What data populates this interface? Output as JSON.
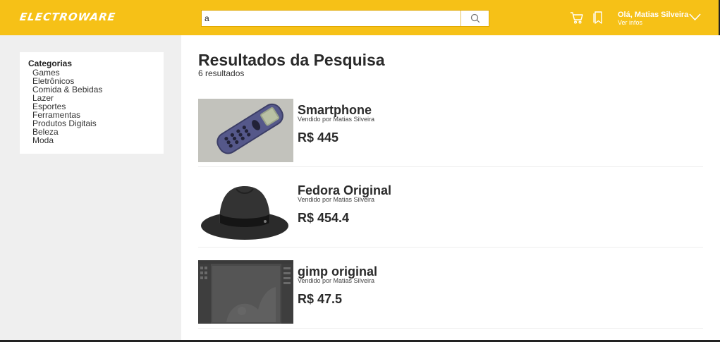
{
  "header": {
    "logo": "ELECTROWARE",
    "search_value": "a",
    "user_greeting": "Olá, Matias Silveira",
    "user_sub": "Ver infos",
    "accent_color": "#f6c117"
  },
  "sidebar": {
    "title": "Categorias",
    "items": [
      "Games",
      "Eletrônicos",
      "Comida & Bebidas",
      "Lazer",
      "Esportes",
      "Ferramentas",
      "Produtos Digitais",
      "Beleza",
      "Moda"
    ]
  },
  "main": {
    "title": "Resultados da Pesquisa",
    "count": "6 resultados",
    "results": [
      {
        "name": "Smartphone",
        "seller": "Vendido por Matias Silveira",
        "price": "R$ 445",
        "image": "phone-image"
      },
      {
        "name": "Fedora Original",
        "seller": "Vendido por Matias Silveira",
        "price": "R$ 454.4",
        "image": "hat-image"
      },
      {
        "name": "gimp original",
        "seller": "Vendido por Matias Silveira",
        "price": "R$ 47.5",
        "image": "gimp-screenshot-image"
      }
    ]
  },
  "icons": {
    "search": "search-icon",
    "cart": "cart-icon",
    "bookmark": "bookmark-icon",
    "chevron": "chevron-down-icon"
  }
}
